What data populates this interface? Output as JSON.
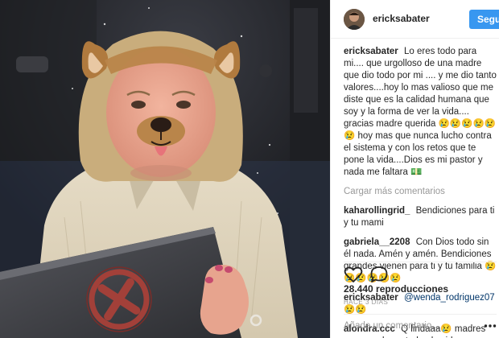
{
  "header": {
    "username": "ericksabater",
    "follow_label": "Seguir"
  },
  "caption": {
    "username": "ericksabater",
    "text": "Lo eres todo para mi.... que urgolloso de una madre que dio todo por mi .... y me dio tanto valores....hoy lo mas valioso que me diste que es la calidad humana que soy y la forma de ver la vida.... gracias madre querida 😢😢😢😢😢😢 hoy mas que nunca lucho contra el sistema y con los retos que te pone la vida....Dios es mi pastor y nada me faltara 💵"
  },
  "load_more": "Cargar más comentarios",
  "comments": [
    {
      "username": "kaharollingrid_",
      "text": "Bendiciones para ti y tu mami"
    },
    {
      "username": "gabriela__2208",
      "text": "Con Dios todo sin él nada. Amén y amén. Bendiciones grandes vienen para ti y tu familia 😢😢😢😢😢😢"
    },
    {
      "username": "ericksabater",
      "mention": "@wenda_rodriguez07",
      "text": "😢😢"
    },
    {
      "username": "alondra.ccc",
      "text": "Q lindaaa😢 madres que nos duren todaa la vidaa"
    }
  ],
  "views": "28.440 reproducciones",
  "timestamp": "HACE 3 DÍAS",
  "add_comment_placeholder": "Añade un comentario...",
  "icons": {
    "like": "heart-icon",
    "comment": "comment-bubble-icon",
    "more": "ellipsis-icon"
  },
  "colors": {
    "follow_button": "#3897f0",
    "muted_text": "#999999",
    "mention": "#003569"
  }
}
